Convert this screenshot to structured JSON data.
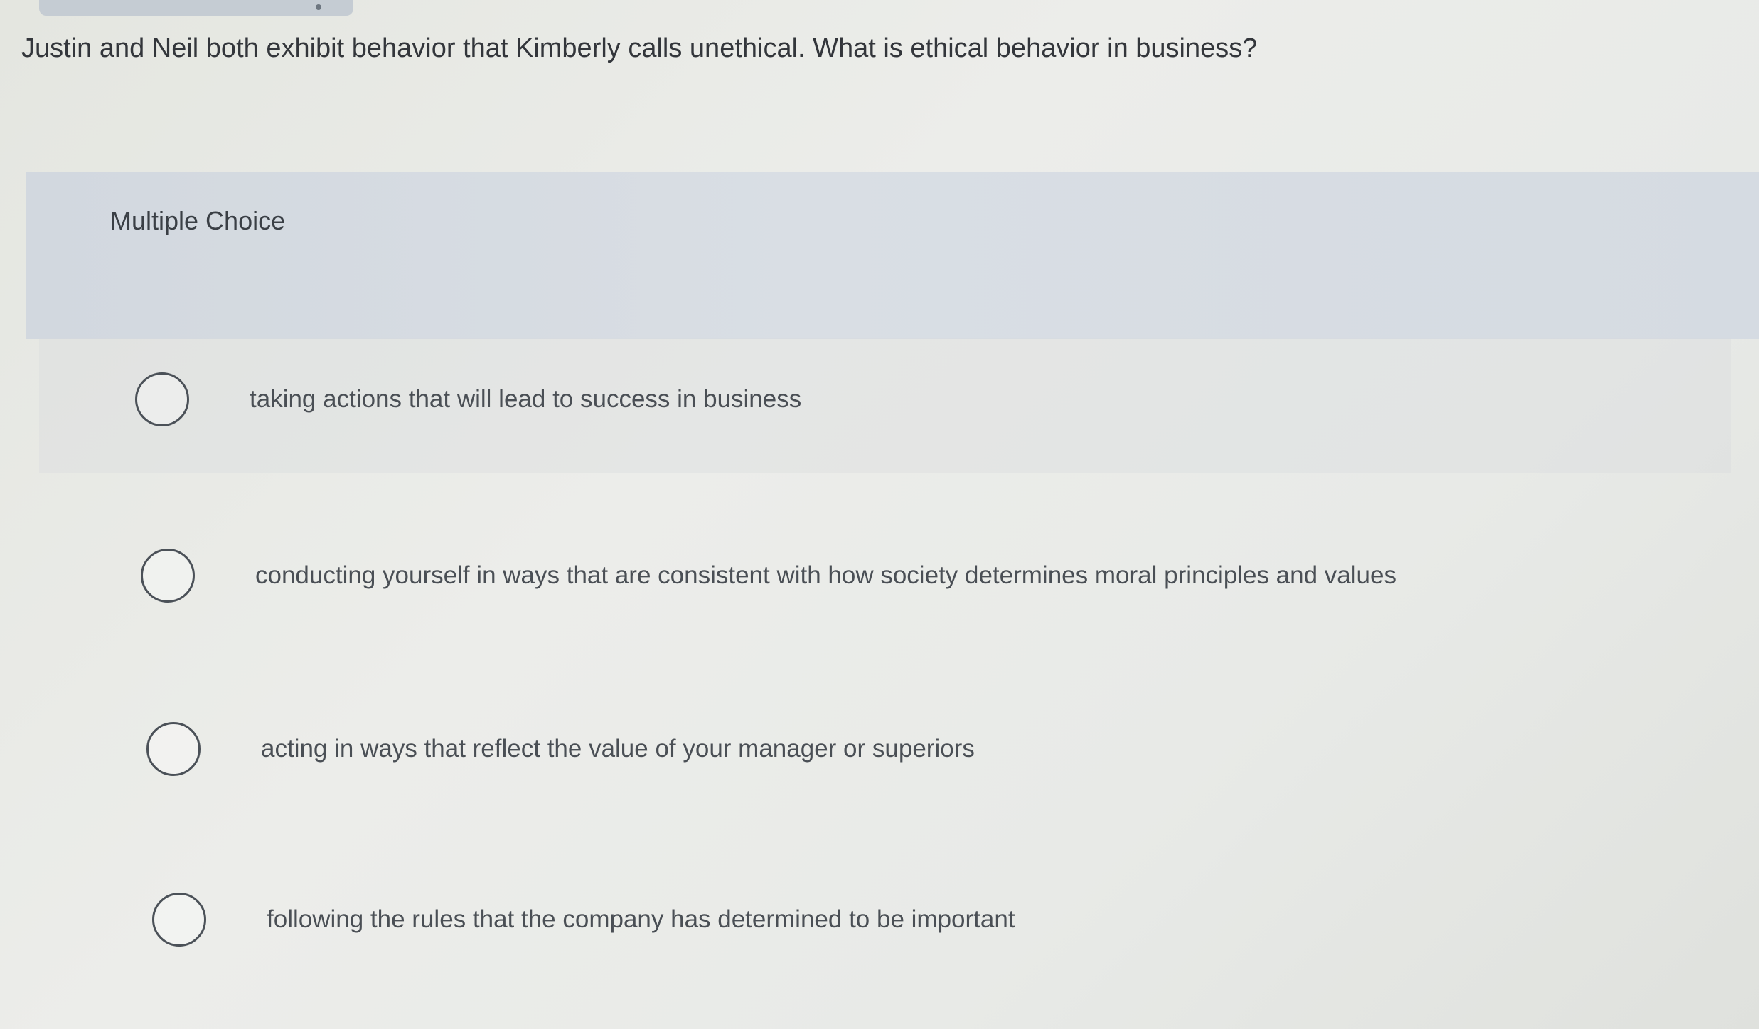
{
  "question": {
    "text": "Justin and Neil both exhibit behavior that Kimberly calls unethical. What is ethical behavior in business?"
  },
  "section": {
    "label": "Multiple Choice"
  },
  "options": [
    {
      "label": "taking actions that will lead to success in business",
      "selected": false
    },
    {
      "label": "conducting yourself in ways that are consistent with how society determines moral principles and values",
      "selected": false
    },
    {
      "label": "acting in ways that reflect the value of your manager or superiors",
      "selected": false
    },
    {
      "label": "following the rules that the company has determined to be important",
      "selected": false
    }
  ],
  "colors": {
    "background": "#e8eae6",
    "header_band": "#d6dce3",
    "text": "#33363b",
    "radio_border": "#4b5158"
  }
}
